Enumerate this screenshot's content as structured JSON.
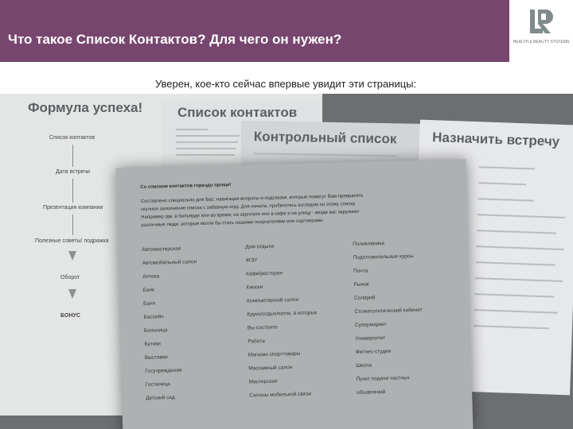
{
  "header": {
    "title": "Что такое Список Контактов? Для чего он нужен?",
    "background": "#77466f"
  },
  "logo": {
    "icon": "lr-logo-icon",
    "text": "HEALTH & BEAUTY SYSTEMS"
  },
  "subtitle": "Уверен, кое-кто сейчас впервые увидит эти страницы:",
  "photo": {
    "formula_page": {
      "title": "Формула успеха!",
      "steps": [
        "Список контактов",
        "Дата встречи",
        "Презентация компании",
        "Полезные советы/ подражка",
        "Оборот",
        "БОНУС"
      ]
    },
    "contacts_page": {
      "title": "Список контактов"
    },
    "control_page": {
      "title": "Контрольный список"
    },
    "meeting_page": {
      "title": "Назначить встречу"
    },
    "main_page": {
      "heading": "Со списком контактов гораздо проще!",
      "paragraph": [
        "Составлено специально для Вас: навигация вопросы и подсказки, которые помогут Вам превратить",
        "скучное заполнение списка с забавную игру. Для начала, пробегитесь взглядом по этому списку.",
        "Например где, в бильярде или во время, на зарплате или в кафе и на улицу - везде вас окружают",
        "различные люди, которые могли бы стать нашими покупателями или партнерами."
      ],
      "col1": [
        "Автомастерская",
        "Автомобильный салон",
        "Аптека",
        "Банк",
        "Баня",
        "Бассейн",
        "Больница",
        "Бутики",
        "Выставки",
        "Госучреждения",
        "Гостиница",
        "Детский сад"
      ],
      "col2": [
        "Дом отдыха",
        "ЖЭУ",
        "Кафе/ресторан",
        "Киоски",
        "Компьютерный салон",
        "Круиз/отдых/каток, в которых",
        "Вы состоите",
        "Работа",
        "Магазин спорттовары",
        "Массажный салон",
        "Мастерская",
        "Салоны мобильной связи"
      ],
      "col3": [
        "Поликлиника",
        "Подготовительные курсы",
        "Почта",
        "Рынок",
        "Солярий",
        "Стоматологический кабинет",
        "Супермаркет",
        "Университет",
        "Фитнес-студия",
        "Школа",
        "Пункт подачи частных",
        "объявлений"
      ]
    }
  }
}
